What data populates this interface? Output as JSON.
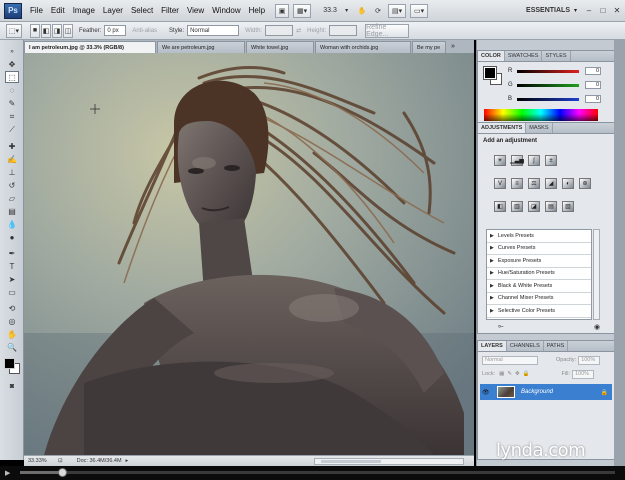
{
  "app": {
    "logo": "Ps",
    "menus": [
      "File",
      "Edit",
      "Image",
      "Layer",
      "Select",
      "Filter",
      "View",
      "Window",
      "Help"
    ],
    "zoom": "33.3",
    "workspace": "ESSENTIALS"
  },
  "options_bar": {
    "feather_label": "Feather:",
    "feather_value": "0 px",
    "antialias_label": "Anti-alias",
    "style_label": "Style:",
    "style_value": "Normal",
    "width_label": "Width:",
    "height_label": "Height:",
    "refine_edge_label": "Refine Edge..."
  },
  "doc_tabs": [
    {
      "label": "I am petroleum.jpg @ 33.3% (RGB/8)",
      "active": true
    },
    {
      "label": "We are petroleum.jpg",
      "active": false
    },
    {
      "label": "White towel.jpg",
      "active": false
    },
    {
      "label": "Woman with orchids.jpg",
      "active": false
    },
    {
      "label": "Be my pe",
      "active": false
    }
  ],
  "status_bar": {
    "zoom": "33.33%",
    "doc": "Doc: 36.4M/36.4M"
  },
  "video": {
    "progress": 0.07
  },
  "color_panel": {
    "tabs": [
      "COLOR",
      "SWATCHES",
      "STYLES"
    ],
    "channels": [
      {
        "label": "R",
        "value": "0",
        "color": "#e02020"
      },
      {
        "label": "G",
        "value": "0",
        "color": "#20a020"
      },
      {
        "label": "B",
        "value": "0",
        "color": "#2040d0"
      }
    ]
  },
  "adjustments_panel": {
    "tabs": [
      "ADJUSTMENTS",
      "MASKS"
    ],
    "title": "Add an adjustment",
    "presets": [
      "Levels Presets",
      "Curves Presets",
      "Exposure Presets",
      "Hue/Saturation Presets",
      "Black & White Presets",
      "Channel Mixer Presets",
      "Selective Color Presets"
    ]
  },
  "layers_panel": {
    "tabs": [
      "LAYERS",
      "CHANNELS",
      "PATHS"
    ],
    "blend_mode": "Normal",
    "opacity_label": "Opacity:",
    "opacity_value": "100%",
    "lock_label": "Lock:",
    "fill_label": "Fill:",
    "fill_value": "100%",
    "layers": [
      {
        "name": "Background",
        "selected": true
      }
    ]
  },
  "watermark": "lynda.com"
}
